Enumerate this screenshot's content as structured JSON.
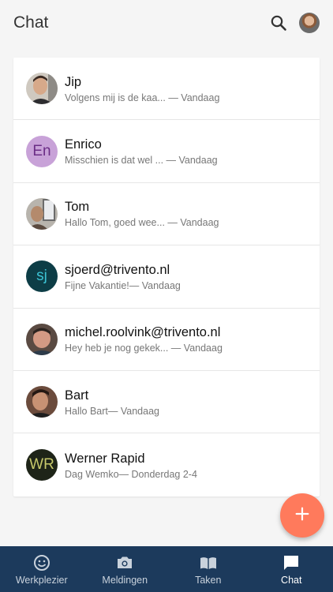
{
  "header": {
    "title": "Chat",
    "search_icon": "search-icon",
    "profile_icon": "profile-avatar"
  },
  "chats": [
    {
      "name": "Jip",
      "preview": "Volgens mij is de kaa... — Vandaag",
      "avatar": {
        "type": "photo"
      }
    },
    {
      "name": "Enrico",
      "preview": "Misschien is dat wel ... — Vandaag",
      "avatar": {
        "type": "initials",
        "initials": "En",
        "bg": "#c8a2d8",
        "fg": "#6b2d86"
      }
    },
    {
      "name": "Tom",
      "preview": "Hallo Tom, goed wee... — Vandaag",
      "avatar": {
        "type": "photo"
      }
    },
    {
      "name": "sjoerd@trivento.nl",
      "preview": "Fijne Vakantie!— Vandaag",
      "avatar": {
        "type": "initials",
        "initials": "sj",
        "bg": "#0d3d46",
        "fg": "#3cc3d4"
      }
    },
    {
      "name": "michel.roolvink@trivento.nl",
      "preview": "Hey heb je nog gekek... — Vandaag",
      "avatar": {
        "type": "photo"
      }
    },
    {
      "name": "Bart",
      "preview": "Hallo Bart— Vandaag",
      "avatar": {
        "type": "photo"
      }
    },
    {
      "name": "Werner Rapid",
      "preview": "Dag Wemko— Donderdag 2-4",
      "avatar": {
        "type": "initials",
        "initials": "WR",
        "bg": "#1e2418",
        "fg": "#c6c86a"
      }
    }
  ],
  "fab": {
    "icon": "plus-icon",
    "color": "#ff7a5c"
  },
  "nav": [
    {
      "label": "Werkplezier",
      "icon": "smiley-icon"
    },
    {
      "label": "Meldingen",
      "icon": "camera-icon"
    },
    {
      "label": "Taken",
      "icon": "book-icon"
    },
    {
      "label": "Chat",
      "icon": "chat-bubble-icon",
      "active": true
    }
  ],
  "colors": {
    "nav_bg": "#1c3a5c",
    "accent": "#ff7a5c"
  }
}
